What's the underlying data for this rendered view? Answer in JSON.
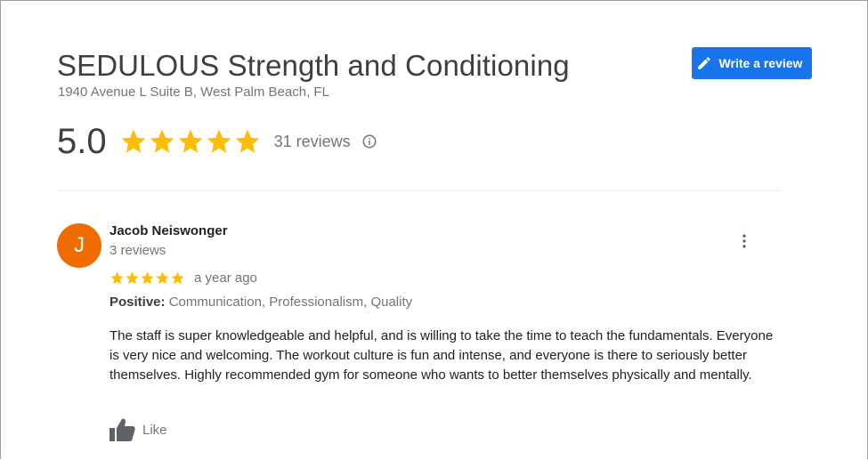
{
  "place": {
    "title": "SEDULOUS Strength and Conditioning",
    "address": "1940 Avenue L Suite B, West Palm Beach, FL"
  },
  "actions": {
    "write_review_label": "Write a review",
    "write_review_icon": "pencil-icon"
  },
  "rating": {
    "value": "5.0",
    "stars": 5,
    "reviews_label": "31 reviews",
    "info_icon": "info-icon"
  },
  "review": {
    "avatar_initial": "J",
    "reviewer_name": "Jacob Neiswonger",
    "reviewer_reviews": "3 reviews",
    "stars": 5,
    "time": "a year ago",
    "positive_label": "Positive:",
    "positive_values": "Communication, Professionalism, Quality",
    "text": "The staff is super knowledgeable and helpful, and is willing to take the time to teach the fundamentals. Everyone is very nice and welcoming. The workout culture is fun and intense, and everyone is there to seriously better themselves. Highly recommended gym for someone who wants to better themselves physically and mentally.",
    "like_label": "Like",
    "more_icon": "more-vertical-icon",
    "like_icon": "thumbs-up-icon"
  },
  "colors": {
    "accent": "#1a73e8",
    "star": "#fbbc04",
    "avatar": "#ef6c00",
    "muted_text": "#70757a"
  }
}
